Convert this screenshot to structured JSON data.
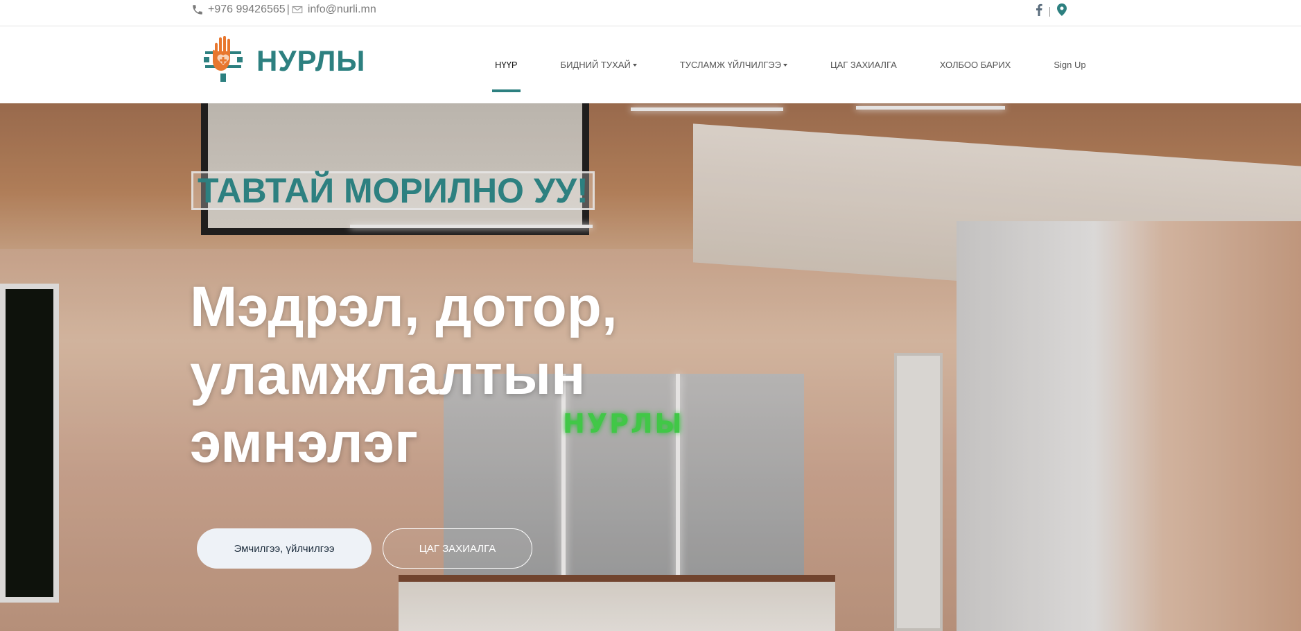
{
  "topbar": {
    "phone": "+976 99426565",
    "separator": "|",
    "email": "info@nurli.mn",
    "icons": [
      "phone-icon",
      "mail-icon",
      "facebook-icon",
      "map-marker-icon"
    ],
    "social_separator": "|"
  },
  "brand": {
    "name": "НУРЛЫ",
    "logo": "nurly-hand-heart-logo"
  },
  "nav": {
    "items": [
      {
        "label": "НҮҮР",
        "active": true,
        "dropdown": false
      },
      {
        "label": "БИДНИЙ ТУХАЙ",
        "active": false,
        "dropdown": true
      },
      {
        "label": "ТУСЛАМЖ ҮЙЛЧИЛГЭЭ",
        "active": false,
        "dropdown": true
      },
      {
        "label": "ЦАГ ЗАХИАЛГА",
        "active": false,
        "dropdown": false
      },
      {
        "label": "ХОЛБОО БАРИХ",
        "active": false,
        "dropdown": false
      },
      {
        "label": "Sign Up",
        "active": false,
        "dropdown": false
      }
    ]
  },
  "hero": {
    "welcome": "ТАВТАЙ МОРИЛНО УУ!",
    "headline": "Мэдрэл, дотор, уламжлалтын эмнэлэг",
    "sign_text": "НУРЛЫ",
    "primary_button": "Эмчилгээ, үйлчилгээ",
    "secondary_button": "ЦАГ ЗАХИАЛГА"
  },
  "colors": {
    "accent": "#2d8080",
    "logo_orange": "#e8772e",
    "sign_green": "#45e04f"
  }
}
